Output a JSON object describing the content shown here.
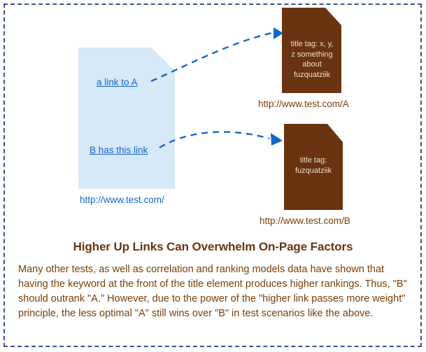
{
  "frame": {
    "border_color": "#3a5488",
    "background": "#ffffff"
  },
  "colors": {
    "doc_brown": "#6b3410",
    "doc_blue_fill": "#d7e8f7",
    "link_blue": "#1468c8",
    "arrow_blue": "#1468c8",
    "text_brown": "#7a3f0a",
    "heading_brown": "#6b3410",
    "doc_text_light": "#ecdfc9"
  },
  "diagram": {
    "source_document": {
      "name": "source-page",
      "url_label": "http://www.test.com/",
      "links": [
        {
          "label": "a link to A",
          "target": "document-a"
        },
        {
          "label": "B has this link",
          "target": "document-b"
        }
      ]
    },
    "target_documents": [
      {
        "name": "document-a",
        "title_tag_text": "title tag: x, y,\nz something\nabout\nfuzquatziik",
        "url_label": "http://www.test.com/A"
      },
      {
        "name": "document-b",
        "title_tag_text": "title tag:\nfuzquatziik",
        "url_label": "http://www.test.com/B"
      }
    ],
    "connectors": [
      {
        "from": "a link to A",
        "to": "document-a",
        "style": "dashed-curved-arrow"
      },
      {
        "from": "B has this link",
        "to": "document-b",
        "style": "dashed-curved-arrow"
      }
    ]
  },
  "caption": {
    "heading": "Higher Up Links Can Overwhelm On-Page Factors",
    "body": "Many other tests, as well as correlation and ranking models data have shown that having the keyword at the front of the title element produces higher rankings. Thus, \"B\" should outrank \"A.\" However, due to the power of the \"higher link passes more weight\" principle, the less optimal \"A\" still wins over \"B\" in test scenarios like the above."
  }
}
